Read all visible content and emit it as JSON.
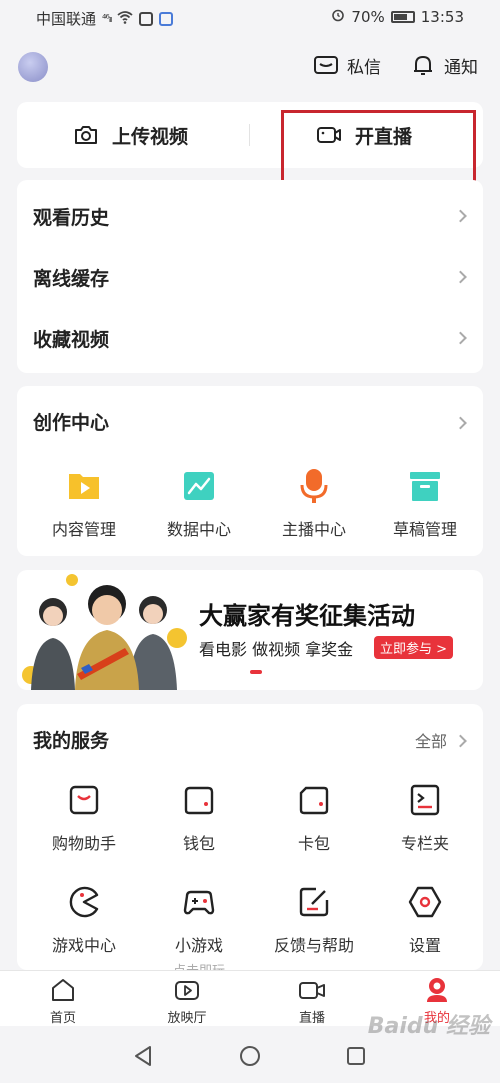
{
  "status_bar": {
    "carrier": "中国联通",
    "signal": "⁴⁶ᵢₗₗ",
    "battery": "70%",
    "time": "13:53"
  },
  "header": {
    "messages_label": "私信",
    "notifications_label": "通知"
  },
  "upload": {
    "upload_label": "上传视频",
    "live_label": "开直播"
  },
  "history": {
    "items": [
      {
        "label": "观看历史"
      },
      {
        "label": "离线缓存"
      },
      {
        "label": "收藏视频"
      }
    ]
  },
  "creator": {
    "title": "创作中心",
    "items": [
      {
        "label": "内容管理",
        "icon": "play-folder-icon",
        "color": "#f7c12b"
      },
      {
        "label": "数据中心",
        "icon": "chart-icon",
        "color": "#3fd1c0"
      },
      {
        "label": "主播中心",
        "icon": "microphone-icon",
        "color": "#f26b2a"
      },
      {
        "label": "草稿管理",
        "icon": "archive-box-icon",
        "color": "#3fd1c0"
      }
    ]
  },
  "banner": {
    "title": "大赢家有奖征集活动",
    "subtitle": "看电影 做视频 拿奖金",
    "cta": "立即参与 >"
  },
  "services": {
    "title": "我的服务",
    "all_label": "全部",
    "items": [
      {
        "label": "购物助手",
        "icon": "shopping-bag-icon"
      },
      {
        "label": "钱包",
        "icon": "wallet-icon"
      },
      {
        "label": "卡包",
        "icon": "card-wallet-icon"
      },
      {
        "label": "专栏夹",
        "icon": "column-folder-icon"
      },
      {
        "label": "游戏中心",
        "icon": "pacman-icon"
      },
      {
        "label": "小游戏",
        "icon": "gamepad-icon",
        "sublabel": "点击即玩"
      },
      {
        "label": "反馈与帮助",
        "icon": "feedback-edit-icon"
      },
      {
        "label": "设置",
        "icon": "settings-hexagon-icon"
      }
    ]
  },
  "bottom_nav": {
    "items": [
      {
        "label": "首页",
        "icon": "home-icon"
      },
      {
        "label": "放映厅",
        "icon": "theater-play-icon"
      },
      {
        "label": "直播",
        "icon": "live-camera-icon"
      },
      {
        "label": "我的",
        "icon": "profile-icon"
      }
    ],
    "active_color": "#e8333b"
  },
  "watermark": "Baidu 经验"
}
